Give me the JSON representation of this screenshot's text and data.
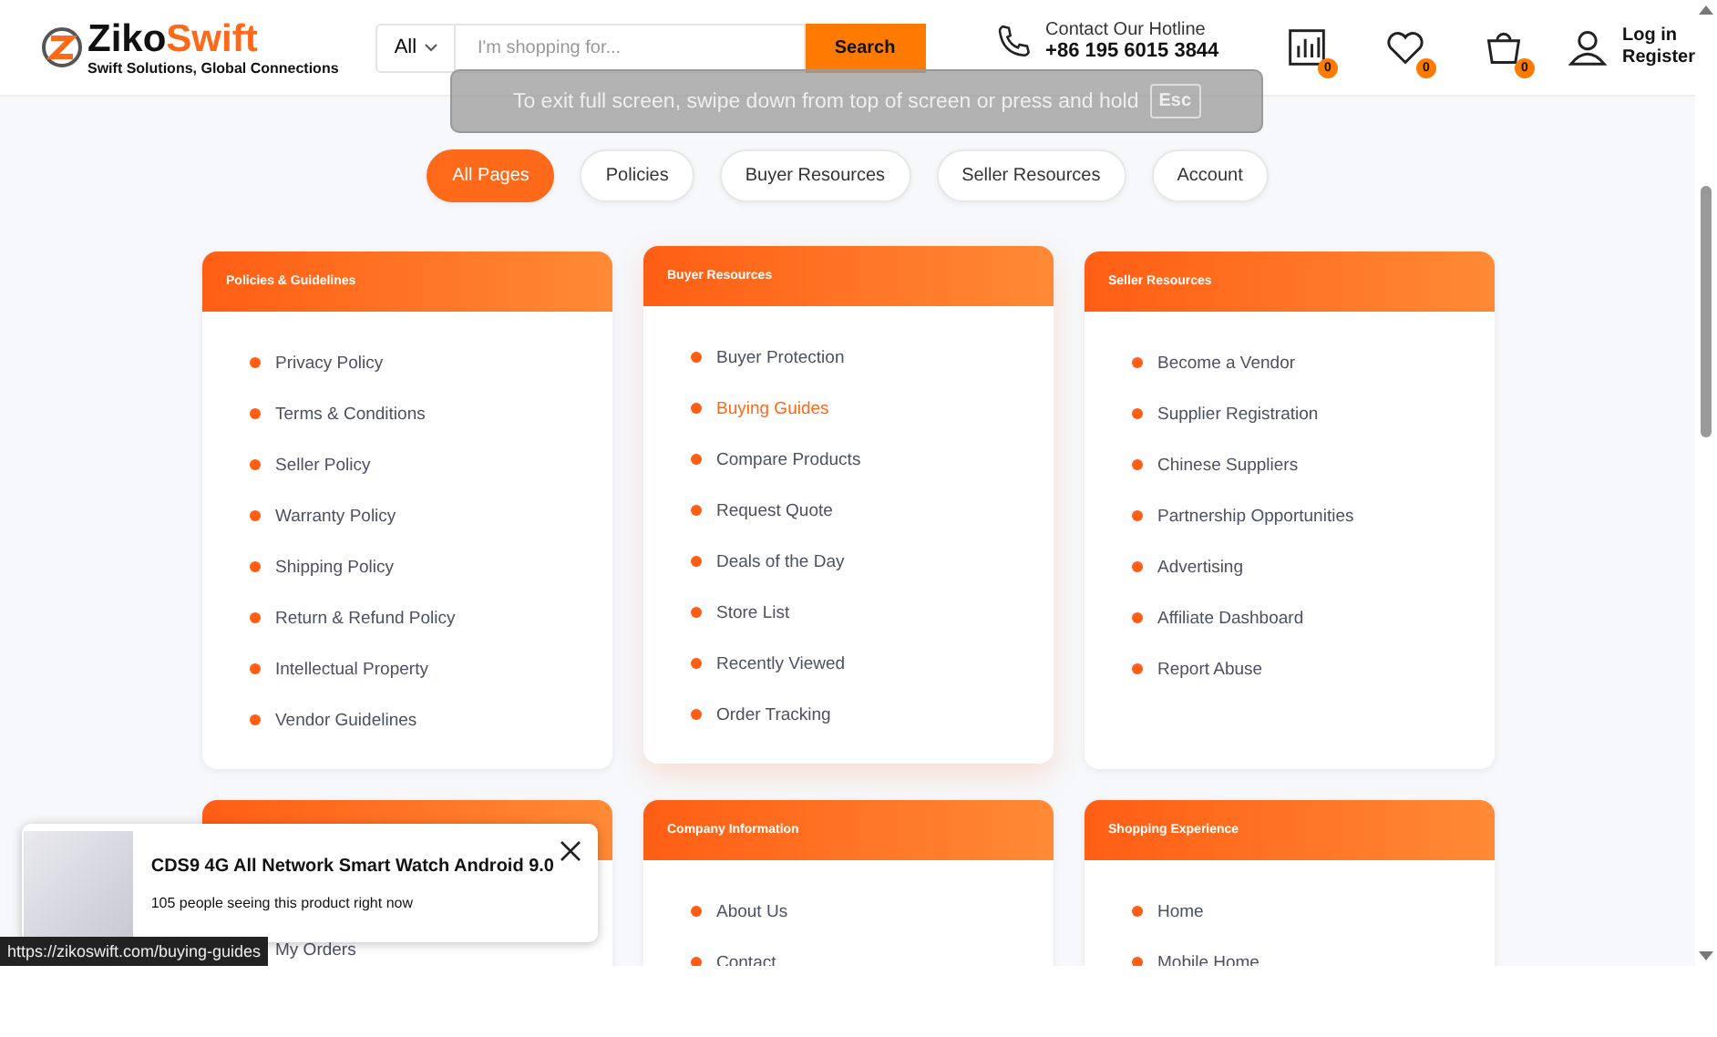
{
  "header": {
    "logo": {
      "brand_dark": "Ziko",
      "brand_accent": "Swift",
      "tagline": "Swift Solutions, Global Connections"
    },
    "search": {
      "category": "All",
      "placeholder": "I'm shopping for...",
      "button": "Search"
    },
    "hotline": {
      "label": "Contact Our Hotline",
      "number": "+86 195 6015 3844"
    },
    "counters": [
      {
        "kind": "compare",
        "count": "0"
      },
      {
        "kind": "wishlist",
        "count": "0"
      },
      {
        "kind": "cart",
        "count": "0"
      }
    ],
    "account": {
      "line1": "Log in",
      "line2": "Register"
    }
  },
  "fullscreen_notice": {
    "text": "To exit full screen, swipe down from top of screen or press and hold",
    "key": "Esc"
  },
  "tabs": [
    {
      "label": "All Pages",
      "selected": true
    },
    {
      "label": "Policies",
      "selected": false
    },
    {
      "label": "Buyer Resources",
      "selected": false
    },
    {
      "label": "Seller Resources",
      "selected": false
    },
    {
      "label": "Account",
      "selected": false
    }
  ],
  "cards": [
    {
      "title": "Policies & Guidelines",
      "raised": false,
      "items": [
        {
          "label": "Privacy Policy",
          "highlighted": false
        },
        {
          "label": "Terms & Conditions",
          "highlighted": false
        },
        {
          "label": "Seller Policy",
          "highlighted": false
        },
        {
          "label": "Warranty Policy",
          "highlighted": false
        },
        {
          "label": "Shipping Policy",
          "highlighted": false
        },
        {
          "label": "Return & Refund Policy",
          "highlighted": false
        },
        {
          "label": "Intellectual Property",
          "highlighted": false
        },
        {
          "label": "Vendor Guidelines",
          "highlighted": false
        }
      ]
    },
    {
      "title": "Buyer Resources",
      "raised": true,
      "items": [
        {
          "label": "Buyer Protection",
          "highlighted": false
        },
        {
          "label": "Buying Guides",
          "highlighted": true
        },
        {
          "label": "Compare Products",
          "highlighted": false
        },
        {
          "label": "Request Quote",
          "highlighted": false
        },
        {
          "label": "Deals of the Day",
          "highlighted": false
        },
        {
          "label": "Store List",
          "highlighted": false
        },
        {
          "label": "Recently Viewed",
          "highlighted": false
        },
        {
          "label": "Order Tracking",
          "highlighted": false
        }
      ]
    },
    {
      "title": "Seller Resources",
      "raised": false,
      "items": [
        {
          "label": "Become a Vendor",
          "highlighted": false
        },
        {
          "label": "Supplier Registration",
          "highlighted": false
        },
        {
          "label": "Chinese Suppliers",
          "highlighted": false
        },
        {
          "label": "Partnership Opportunities",
          "highlighted": false
        },
        {
          "label": "Advertising",
          "highlighted": false
        },
        {
          "label": "Affiliate Dashboard",
          "highlighted": false
        },
        {
          "label": "Report Abuse",
          "highlighted": false
        }
      ]
    },
    {
      "raised": false,
      "items": [
        {
          "label": "My Orders",
          "highlighted": false
        }
      ]
    },
    {
      "title": "Company Information",
      "raised": false,
      "items": [
        {
          "label": "About Us",
          "highlighted": false
        },
        {
          "label": "Contact",
          "highlighted": false
        }
      ]
    },
    {
      "title": "Shopping Experience",
      "raised": false,
      "items": [
        {
          "label": "Home",
          "highlighted": false
        },
        {
          "label": "Mobile Home",
          "highlighted": false
        }
      ]
    }
  ],
  "toast": {
    "title": "CDS9 4G All Network Smart Watch Android 9.0",
    "text": "105 people seeing this product right now"
  },
  "status_url": "https://zikoswift.com/buying-guides"
}
